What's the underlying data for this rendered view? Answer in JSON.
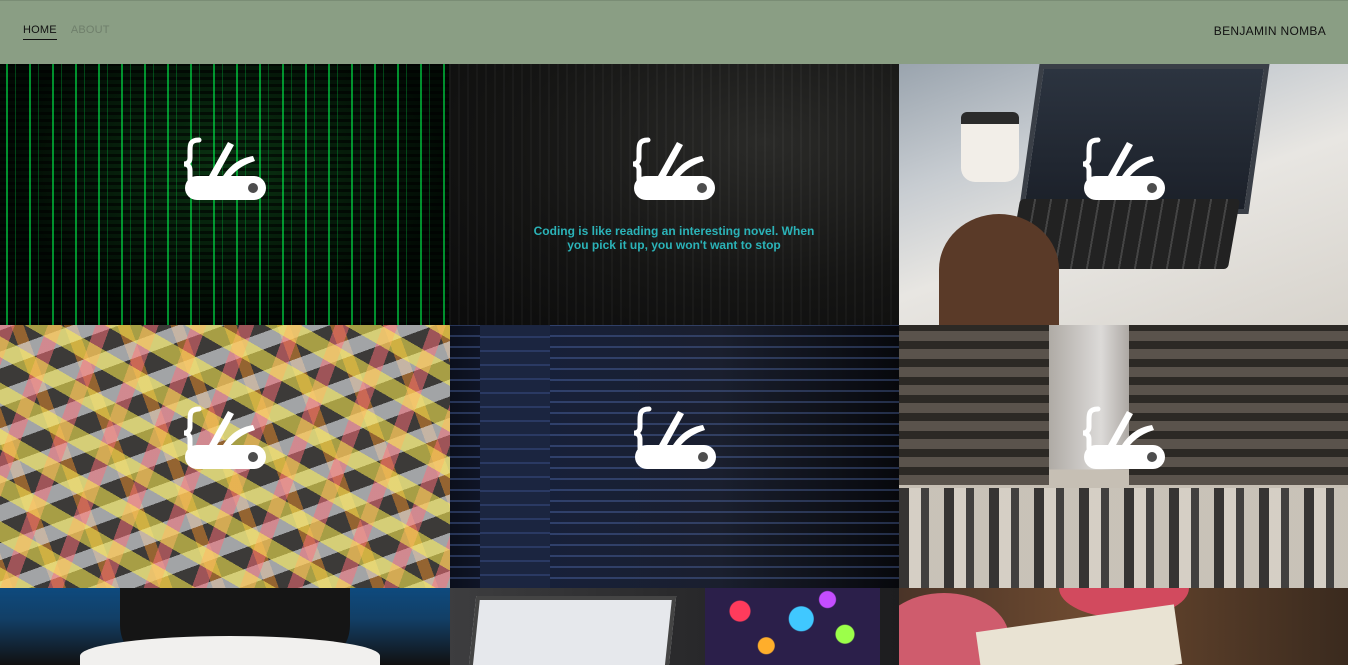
{
  "nav": {
    "links": [
      {
        "label": "HOME",
        "active": true
      },
      {
        "label": "ABOUT",
        "active": false
      }
    ],
    "brand": "BENJAMIN NOMBA"
  },
  "tiles": [
    {
      "scene": "green matrix code",
      "icon": "tools-icon"
    },
    {
      "scene": "dark library",
      "icon": "tools-icon",
      "quote": "Coding is like reading an interesting novel. When you pick it up, you won't want to stop"
    },
    {
      "scene": "laptop with coffee",
      "icon": "tools-icon"
    },
    {
      "scene": "sticky notes wall",
      "icon": "tools-icon"
    },
    {
      "scene": "code editor screen",
      "icon": "tools-icon"
    },
    {
      "scene": "city street crowd",
      "icon": "tools-icon"
    },
    {
      "scene": "person at table",
      "icon": "tools-icon"
    },
    {
      "scene": "laptop with bokeh",
      "icon": "tools-icon"
    },
    {
      "scene": "food table",
      "icon": "tools-icon"
    }
  ],
  "colors": {
    "navbar": "#8a9e84",
    "quote": "#2bb3b8",
    "icon": "#ffffff"
  }
}
